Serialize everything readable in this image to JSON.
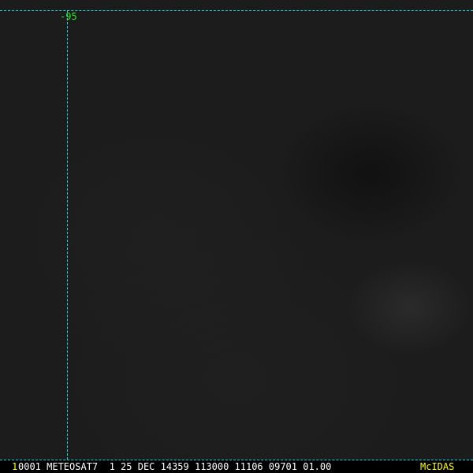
{
  "image": {
    "grid_label": "-95"
  },
  "status_bar": {
    "frame_number": "1",
    "info": "0001 METEOSAT7  1 25 DEC 14359 113000 11106 09701 01.00",
    "brand": "McIDAS"
  },
  "colors": {
    "grid": "#1fd6e0",
    "grid_label": "#22ee22",
    "frame_number": "#ffff00",
    "brand": "#ffff00",
    "status_text": "#ffffff"
  }
}
